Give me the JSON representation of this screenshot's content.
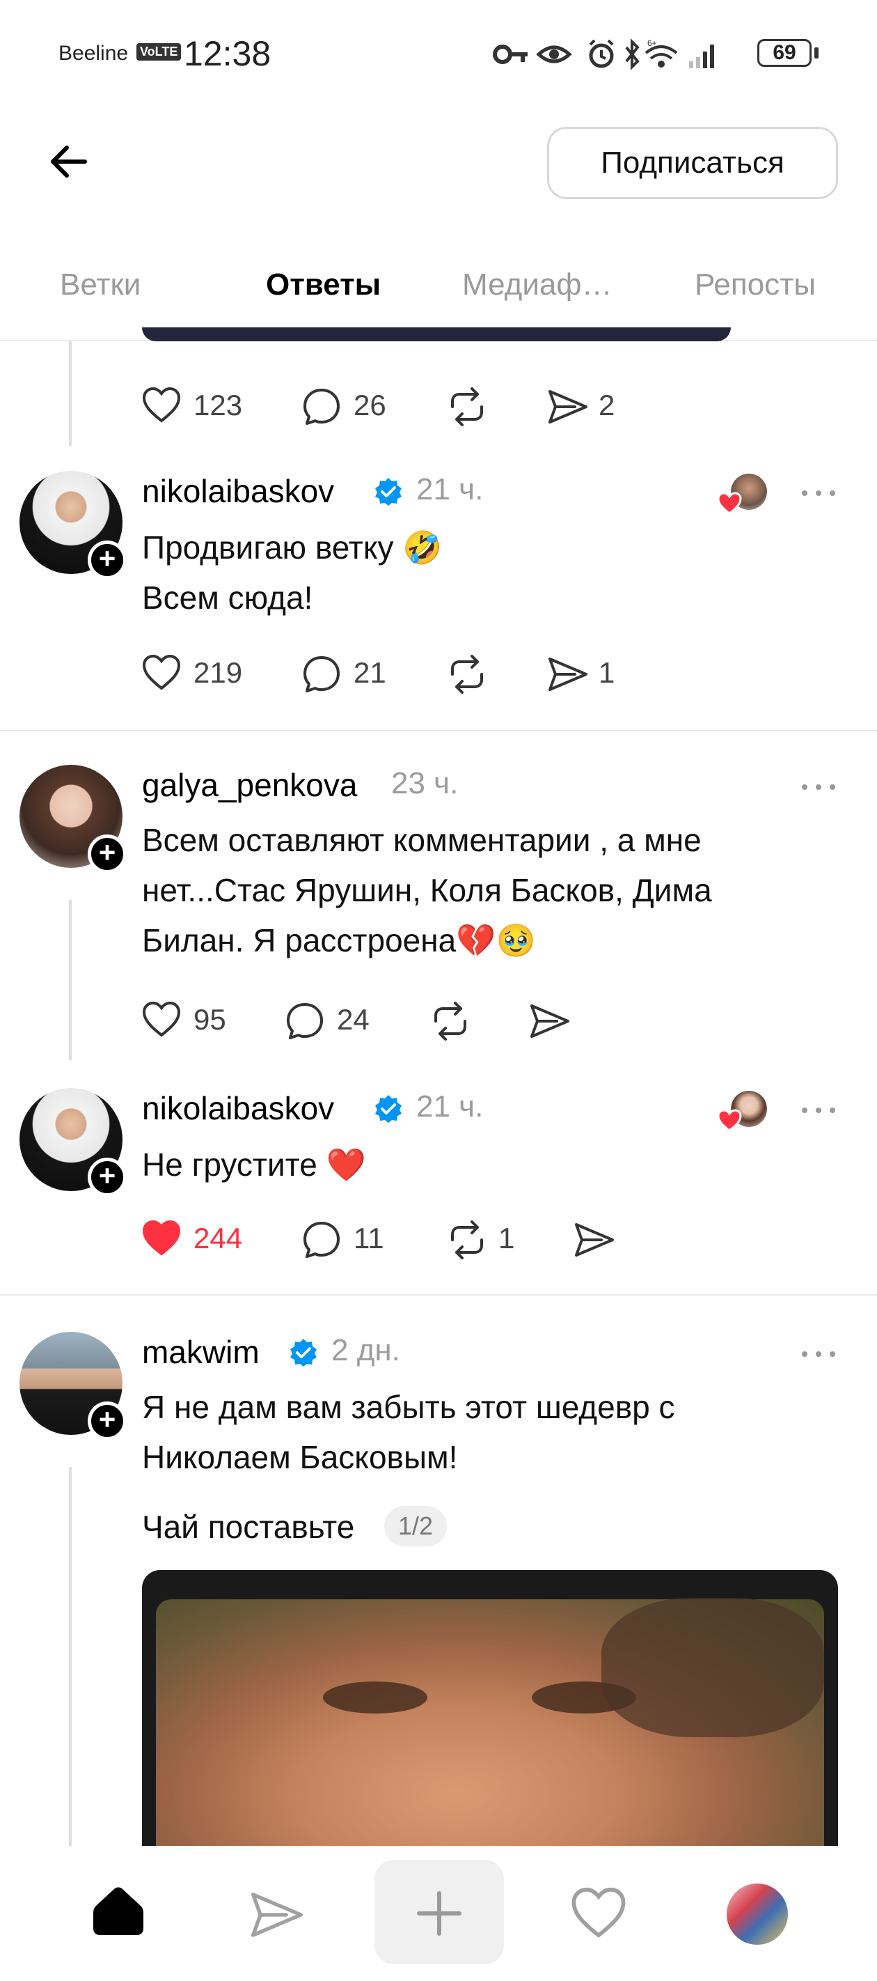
{
  "status_bar": {
    "carrier": "Beeline",
    "volte": "VoLTE",
    "time": "12:38",
    "battery": "69"
  },
  "header": {
    "subscribe_label": "Подписаться"
  },
  "tabs": [
    {
      "label": "Ветки",
      "active": false
    },
    {
      "label": "Ответы",
      "active": true
    },
    {
      "label": "Медиаф…",
      "active": false
    },
    {
      "label": "Репосты",
      "active": false
    }
  ],
  "top_actions": {
    "likes": "123",
    "comments": "26",
    "shares": "2"
  },
  "posts": [
    {
      "username": "nikolaibaskov",
      "verified": true,
      "time": "21 ч.",
      "text": "Продвигаю ветку 🤣\nВсем сюда!",
      "likes": "219",
      "comments": "21",
      "reposts": "",
      "shares": "1",
      "liked": false
    },
    {
      "username": "galya_penkova",
      "verified": false,
      "time": "23 ч.",
      "text": "Всем оставляют комментарии , а мне\nнет...Стас Ярушин, Коля Басков, Дима\nБилан. Я расстроена💔🥹",
      "likes": "95",
      "comments": "24",
      "reposts": "",
      "shares": "",
      "liked": false
    },
    {
      "username": "nikolaibaskov",
      "verified": true,
      "time": "21 ч.",
      "text": "Не грустите ❤️",
      "likes": "244",
      "comments": "11",
      "reposts": "1",
      "shares": "",
      "liked": true
    },
    {
      "username": "makwim",
      "verified": true,
      "time": "2 дн.",
      "text": "Я не дам вам забыть этот шедевр с\nНиколаем Басковым!",
      "subtext": "Чай поставьте",
      "page_indicator": "1/2"
    }
  ],
  "colors": {
    "like_red": "#ff3040",
    "verified_blue": "#0095f6",
    "muted_gray": "#9c9c9c"
  },
  "icons": {
    "back": "arrow-left-icon",
    "more": "more-horizontal-icon",
    "like": "heart-icon",
    "comment": "comment-bubble-icon",
    "repost": "repost-icon",
    "share": "send-icon",
    "nav_home": "home-icon",
    "nav_create": "plus-icon",
    "nav_activity": "heart-icon",
    "nav_profile": "avatar"
  }
}
